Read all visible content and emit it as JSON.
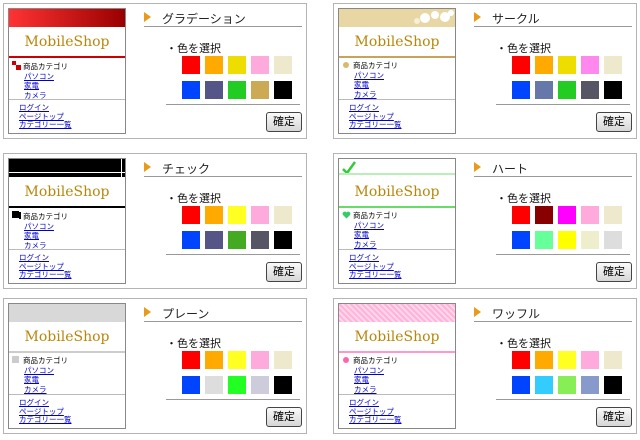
{
  "common": {
    "brand": "MobileShop",
    "category_label": "商品カテゴリ",
    "categories": [
      "パソコン",
      "家電",
      "カメラ"
    ],
    "links": [
      "ログイン",
      "ページトップ",
      "カテゴリー一覧"
    ],
    "select_label": "・色を選択",
    "confirm_label": "確定"
  },
  "panels": [
    {
      "title": "グラデーション",
      "theme": "gradation",
      "accent": "#cc0000",
      "marker": "square-red",
      "colors": [
        "#ff0000",
        "#ffaa00",
        "#eedd00",
        "#ffaadd",
        "#eee8cc",
        "#0044ff",
        "#555588",
        "#22cc22",
        "#ccaa55",
        "#000000"
      ]
    },
    {
      "title": "サークル",
      "theme": "circle",
      "accent": "#c8a35a",
      "marker": "dot-gold",
      "colors": [
        "#ff0000",
        "#ffaa00",
        "#eedd00",
        "#ff88ee",
        "#eee8cc",
        "#0044ff",
        "#6677aa",
        "#22cc22",
        "#555566",
        "#000000"
      ]
    },
    {
      "title": "チェック",
      "theme": "check",
      "accent": "#000000",
      "marker": "square-black",
      "colors": [
        "#ff0000",
        "#ffaa00",
        "#ffff22",
        "#ffaadd",
        "#eee8cc",
        "#0044ff",
        "#555588",
        "#44aa22",
        "#555566",
        "#000000"
      ]
    },
    {
      "title": "ハート",
      "theme": "heart",
      "accent": "#66dd66",
      "marker": "heart-green",
      "colors": [
        "#ff0000",
        "#880000",
        "#ff00ff",
        "#ffaadd",
        "#eee8cc",
        "#0044ff",
        "#66ff99",
        "#ffff00",
        "#eeeecc",
        "#dddddd"
      ]
    },
    {
      "title": "プレーン",
      "theme": "plain",
      "accent": "#cccccc",
      "marker": "square-grey",
      "colors": [
        "#ff0000",
        "#ffaa00",
        "#ffff22",
        "#ffaadd",
        "#eee8cc",
        "#0044ff",
        "#dddddd",
        "#22ff22",
        "#ccccdd",
        "#000000"
      ]
    },
    {
      "title": "ワッフル",
      "theme": "waffle",
      "accent": "#ff99cc",
      "marker": "dot-pink",
      "colors": [
        "#ff0000",
        "#ffaa00",
        "#ffff22",
        "#ffaadd",
        "#eee8cc",
        "#0044ff",
        "#33ccff",
        "#88ee55",
        "#8899cc",
        "#000000"
      ]
    }
  ]
}
